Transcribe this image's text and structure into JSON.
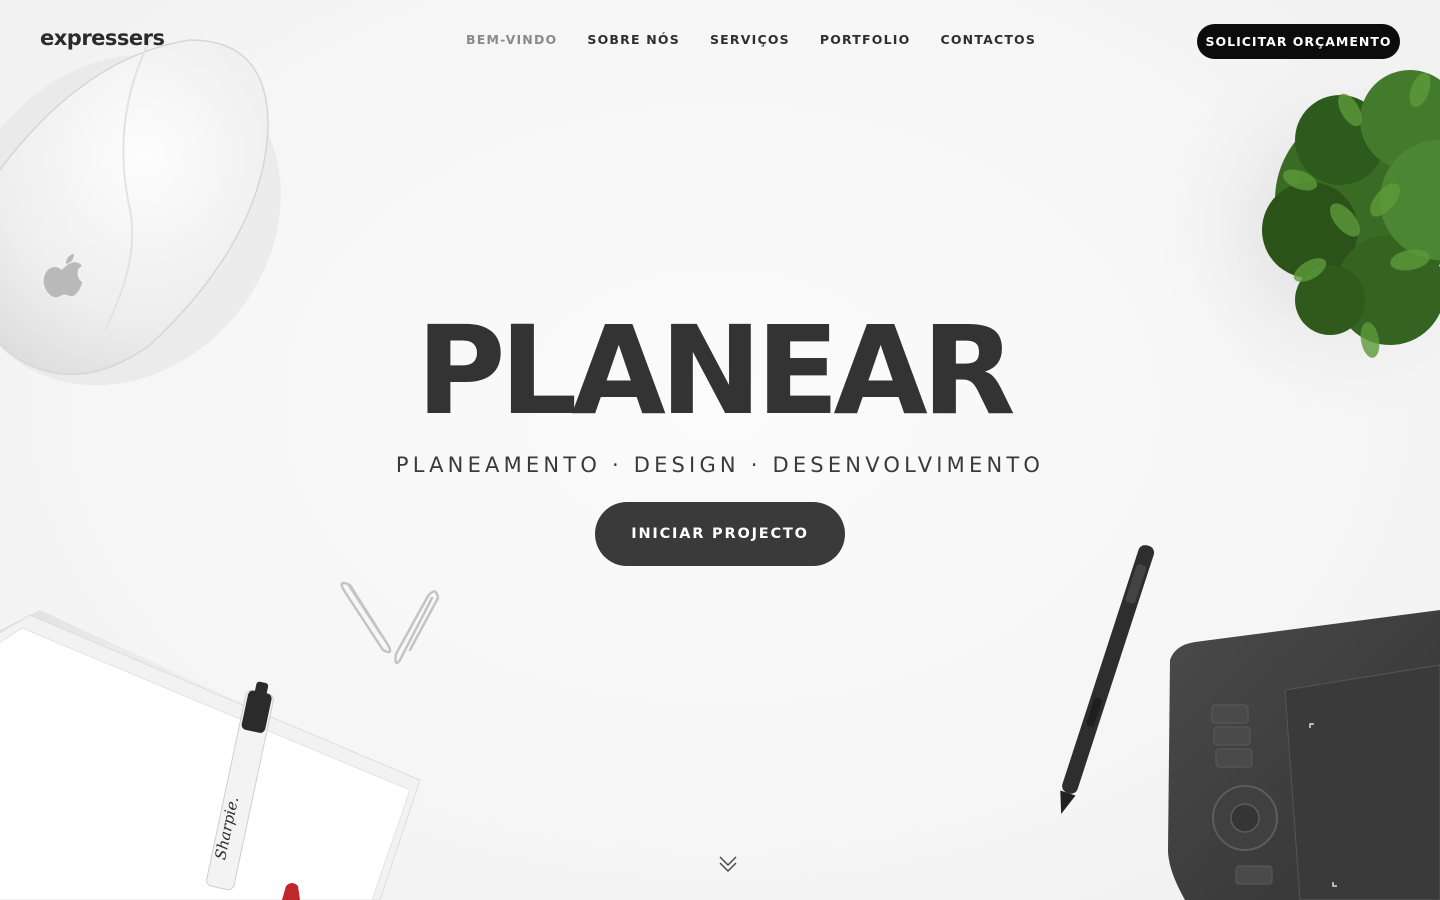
{
  "header": {
    "logo": "expressers",
    "nav": [
      {
        "label": "BEM-VINDO",
        "active": true
      },
      {
        "label": "SOBRE NÓS",
        "active": false
      },
      {
        "label": "SERVIÇOS",
        "active": false
      },
      {
        "label": "PORTFOLIO",
        "active": false
      },
      {
        "label": "CONTACTOS",
        "active": false
      }
    ],
    "quote_button": "SOLICITAR ORÇAMENTO"
  },
  "hero": {
    "title": "PLANEAR",
    "subtitle": "PLANEAMENTO · DESIGN · DESENVOLVIMENTO",
    "cta": "INICIAR PROJECTO"
  },
  "icons": {
    "scroll": "chevron-double-down-icon"
  },
  "colors": {
    "background": "#f7f7f7",
    "text_dark": "#333333",
    "nav_active": "#8a8a8a",
    "quote_button_bg": "#0c0c0c",
    "cta_bg": "#3a3a3a"
  }
}
